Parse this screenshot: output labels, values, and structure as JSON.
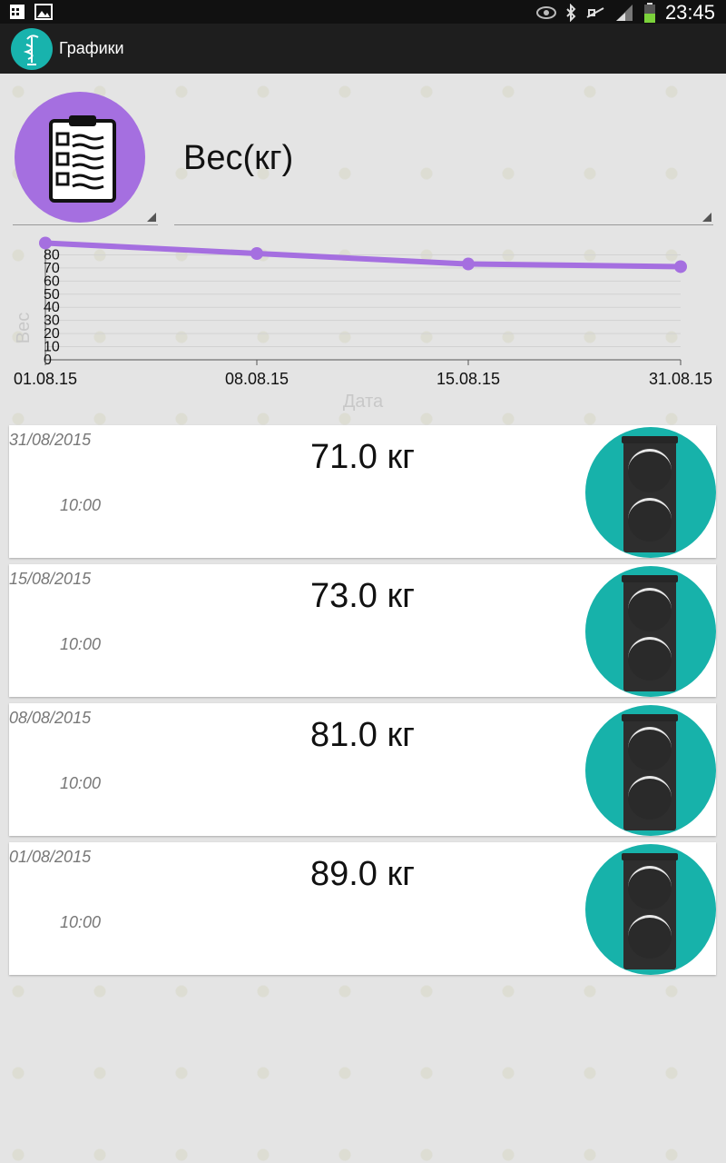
{
  "status_bar": {
    "time": "23:45",
    "icons": [
      "calendar-icon",
      "image-icon",
      "eye-icon",
      "bluetooth-icon",
      "mute-icon",
      "signal-icon",
      "battery-icon"
    ]
  },
  "app_bar": {
    "title": "Графики"
  },
  "header": {
    "param_title": "Вес(кг)",
    "icon": "clipboard-checklist-icon",
    "icon_color": "#a56fe0"
  },
  "chart_data": {
    "type": "line",
    "x": [
      "01.08.15",
      "08.08.15",
      "15.08.15",
      "31.08.15"
    ],
    "series": [
      {
        "values": [
          89,
          81,
          73,
          71
        ],
        "color": "#a56fe0"
      }
    ],
    "y_ticks": [
      0,
      10,
      20,
      30,
      40,
      50,
      60,
      70,
      80
    ],
    "ylabel": "Вес",
    "xlabel": "Дата",
    "ylim": [
      0,
      90
    ]
  },
  "entries": [
    {
      "date": "31/08/2015",
      "time": "10:00",
      "value": "71.0 кг"
    },
    {
      "date": "15/08/2015",
      "time": "10:00",
      "value": "73.0 кг"
    },
    {
      "date": "08/08/2015",
      "time": "10:00",
      "value": "81.0 кг"
    },
    {
      "date": "01/08/2015",
      "time": "10:00",
      "value": "89.0 кг"
    }
  ],
  "colors": {
    "accent_teal": "#17b2aa",
    "accent_purple": "#a56fe0",
    "appbar": "#1e1e1e"
  }
}
